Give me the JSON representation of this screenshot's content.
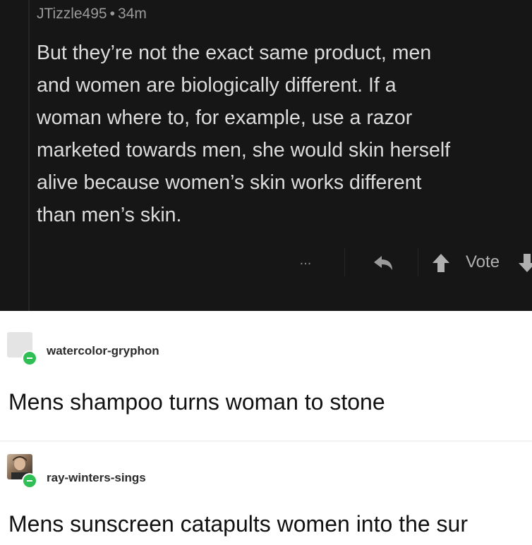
{
  "comment": {
    "username": "JTizzle495",
    "separator": "•",
    "time": "34m",
    "body_lines": [
      "But they’re not the exact same product, men",
      "and women are biologically different. If a",
      "woman where to, for example, use a razor",
      "marketed towards men, she would skin herself",
      "alive because women’s skin works different",
      "than men’s skin."
    ],
    "actions": {
      "more": "...",
      "vote_label": "Vote"
    }
  },
  "posts": [
    {
      "username": "watercolor-gryphon",
      "text": "Mens shampoo turns woman to stone",
      "avatar_icon": "blank-avatar"
    },
    {
      "username": "ray-winters-sings",
      "text": "Mens sunscreen catapults women into the sur",
      "avatar_icon": "photo-avatar"
    }
  ],
  "colors": {
    "dark_bg": "#161616",
    "badge": "#2fbf55"
  }
}
